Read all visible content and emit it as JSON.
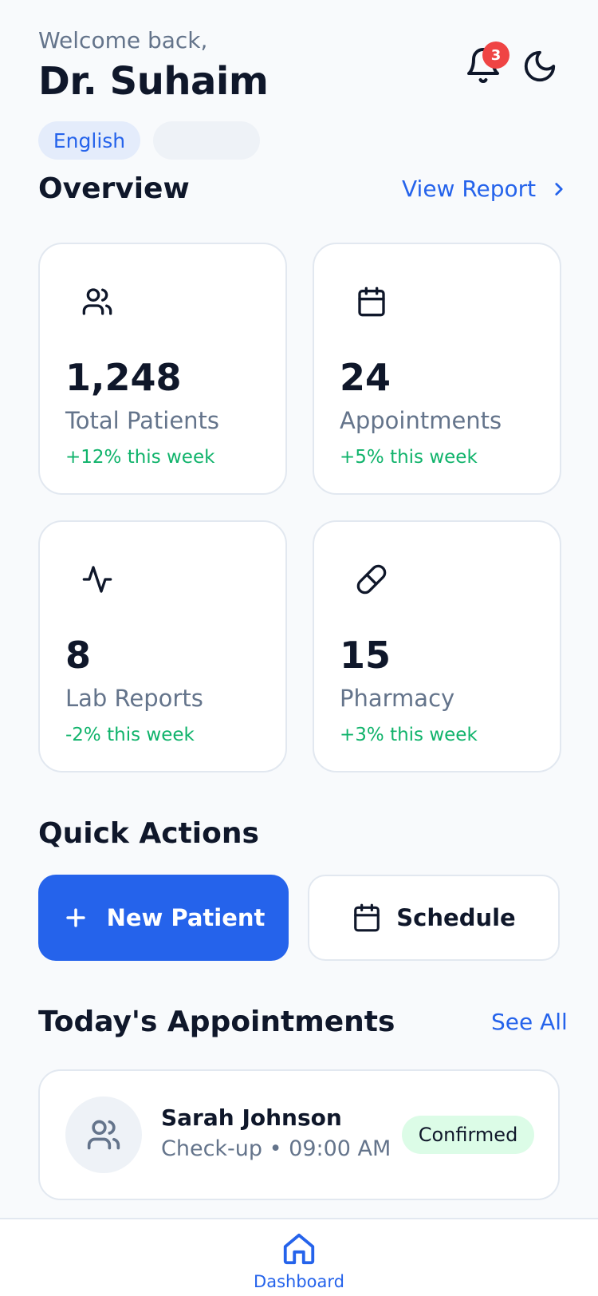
{
  "header": {
    "welcome": "Welcome back,",
    "doctor_name": "Dr. Suhaim",
    "notification_count": "3",
    "language": "English"
  },
  "overview": {
    "title": "Overview",
    "link_label": "View Report",
    "stats": [
      {
        "value": "1,248",
        "label": "Total Patients",
        "change": "+12% this week",
        "icon": "users-icon"
      },
      {
        "value": "24",
        "label": "Appointments",
        "change": "+5% this week",
        "icon": "calendar-icon"
      },
      {
        "value": "8",
        "label": "Lab Reports",
        "change": "-2% this week",
        "icon": "activity-icon"
      },
      {
        "value": "15",
        "label": "Pharmacy",
        "change": "+3% this week",
        "icon": "pill-icon"
      }
    ]
  },
  "quick_actions": {
    "title": "Quick Actions",
    "new_patient": "New Patient",
    "schedule": "Schedule"
  },
  "appointments": {
    "title": "Today's Appointments",
    "see_all": "See All",
    "items": [
      {
        "name": "Sarah Johnson",
        "meta": "Check-up • 09:00 AM",
        "status": "Confirmed"
      }
    ]
  },
  "nav": {
    "dashboard": "Dashboard"
  },
  "colors": {
    "primary": "#2563eb",
    "positive": "#10b36b",
    "badge": "#ef4444",
    "confirmed_bg": "#dcfce7"
  }
}
